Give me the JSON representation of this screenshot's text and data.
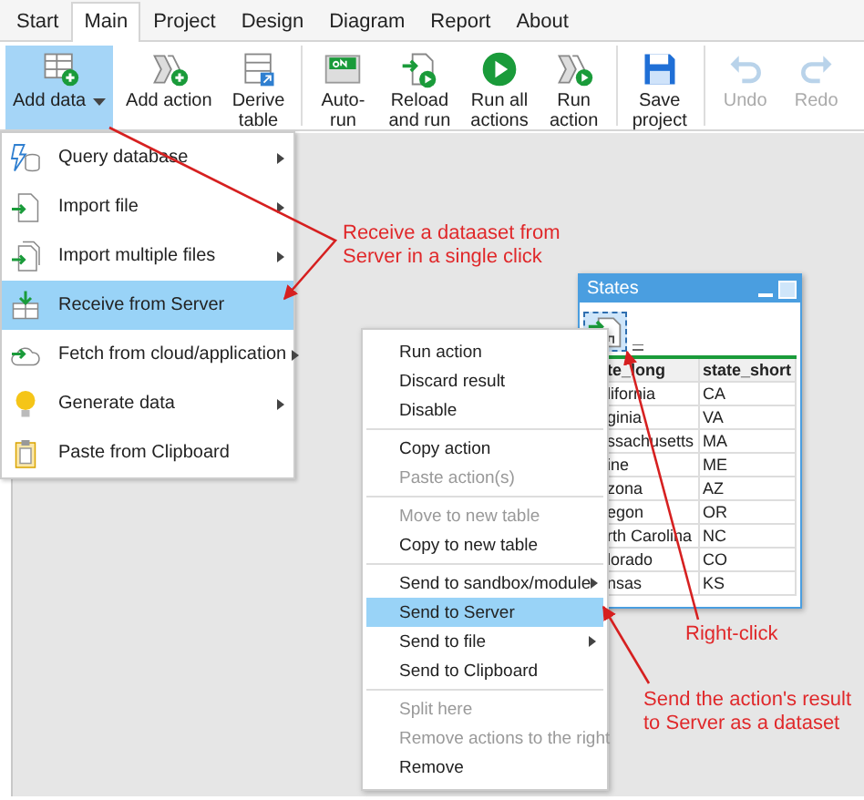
{
  "tabs": [
    {
      "label": "Start",
      "selected": false
    },
    {
      "label": "Main",
      "selected": true
    },
    {
      "label": "Project",
      "selected": false
    },
    {
      "label": "Design",
      "selected": false
    },
    {
      "label": "Diagram",
      "selected": false
    },
    {
      "label": "Report",
      "selected": false
    },
    {
      "label": "About",
      "selected": false
    }
  ],
  "ribbon": [
    {
      "label": [
        "Add data"
      ],
      "selected": true,
      "disabled": false,
      "dropdown": true
    },
    {
      "label": [
        "Add action"
      ],
      "selected": false,
      "disabled": false,
      "dropdown": false
    },
    {
      "label": [
        "Derive",
        "table"
      ],
      "selected": false,
      "disabled": false,
      "dropdown": false
    },
    {
      "label": [
        "Auto-",
        "run"
      ],
      "selected": false,
      "disabled": false,
      "dropdown": false
    },
    {
      "label": [
        "Reload",
        "and run"
      ],
      "selected": false,
      "disabled": false,
      "dropdown": false
    },
    {
      "label": [
        "Run all",
        "actions"
      ],
      "selected": false,
      "disabled": false,
      "dropdown": false
    },
    {
      "label": [
        "Run",
        "action"
      ],
      "selected": false,
      "disabled": false,
      "dropdown": false
    },
    {
      "label": [
        "Save",
        "project"
      ],
      "selected": false,
      "disabled": false,
      "dropdown": false
    },
    {
      "label": [
        "Undo"
      ],
      "selected": false,
      "disabled": true,
      "dropdown": false
    },
    {
      "label": [
        "Redo"
      ],
      "selected": false,
      "disabled": true,
      "dropdown": false
    }
  ],
  "add_data_menu": [
    {
      "label": "Query database",
      "submenu": true,
      "selected": false
    },
    {
      "label": "Import file",
      "submenu": true,
      "selected": false
    },
    {
      "label": "Import multiple files",
      "submenu": true,
      "selected": false
    },
    {
      "label": "Receive from Server",
      "submenu": false,
      "selected": true
    },
    {
      "label": "Fetch from cloud/application",
      "submenu": true,
      "selected": false
    },
    {
      "label": "Generate data",
      "submenu": true,
      "selected": false
    },
    {
      "label": "Paste from Clipboard",
      "submenu": false,
      "selected": false
    }
  ],
  "states_window": {
    "title": "States",
    "columns": [
      "te_long",
      "state_short"
    ],
    "rows": [
      [
        "lifornia",
        "CA"
      ],
      [
        "ginia",
        "VA"
      ],
      [
        "ssachusetts",
        "MA"
      ],
      [
        "ine",
        "ME"
      ],
      [
        "zona",
        "AZ"
      ],
      [
        "egon",
        "OR"
      ],
      [
        "rth Carolina",
        "NC"
      ],
      [
        "lorado",
        "CO"
      ],
      [
        "nsas",
        "KS"
      ]
    ]
  },
  "context_menu": [
    [
      {
        "label": "Run action",
        "disabled": false,
        "submenu": false,
        "selected": false
      },
      {
        "label": "Discard result",
        "disabled": false,
        "submenu": false,
        "selected": false
      },
      {
        "label": "Disable",
        "disabled": false,
        "submenu": false,
        "selected": false
      }
    ],
    [
      {
        "label": "Copy action",
        "disabled": false,
        "submenu": false,
        "selected": false
      },
      {
        "label": "Paste action(s)",
        "disabled": true,
        "submenu": false,
        "selected": false
      }
    ],
    [
      {
        "label": "Move to new table",
        "disabled": true,
        "submenu": false,
        "selected": false
      },
      {
        "label": "Copy to new table",
        "disabled": false,
        "submenu": false,
        "selected": false
      }
    ],
    [
      {
        "label": "Send to sandbox/module",
        "disabled": false,
        "submenu": true,
        "selected": false
      },
      {
        "label": "Send to Server",
        "disabled": false,
        "submenu": false,
        "selected": true
      },
      {
        "label": "Send to file",
        "disabled": false,
        "submenu": true,
        "selected": false
      },
      {
        "label": "Send to Clipboard",
        "disabled": false,
        "submenu": false,
        "selected": false
      }
    ],
    [
      {
        "label": "Split here",
        "disabled": true,
        "submenu": false,
        "selected": false
      },
      {
        "label": "Remove actions to the right",
        "disabled": true,
        "submenu": false,
        "selected": false
      },
      {
        "label": "Remove",
        "disabled": false,
        "submenu": false,
        "selected": false
      }
    ]
  ],
  "annotations": [
    {
      "kind": "receive",
      "lines": [
        "Receive a dataaset from",
        "Server in a single click"
      ]
    },
    {
      "kind": "right-click",
      "lines": [
        "Right-click"
      ]
    },
    {
      "kind": "send",
      "lines": [
        "Send the action's result",
        "to Server as a dataset"
      ]
    }
  ]
}
